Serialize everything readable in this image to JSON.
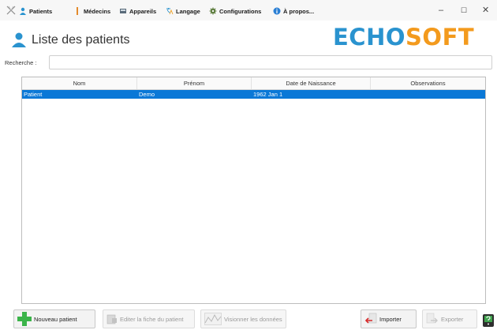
{
  "menu": {
    "items": [
      {
        "label": "Patients",
        "icon": "user-icon"
      },
      {
        "label": "Médecins",
        "icon": "doctor-icon"
      },
      {
        "label": "Appareils",
        "icon": "device-icon"
      },
      {
        "label": "Langage",
        "icon": "language-icon"
      },
      {
        "label": "Configurations",
        "icon": "gear-icon"
      },
      {
        "label": "À propos...",
        "icon": "info-icon"
      }
    ],
    "window_controls": {
      "minimize": "–",
      "maximize": "☐",
      "close": "✕"
    }
  },
  "header": {
    "title": "Liste des patients",
    "logo_part1": "ECHO",
    "logo_part2": "SOFT"
  },
  "search": {
    "label": "Recherche :",
    "value": "",
    "placeholder": ""
  },
  "table": {
    "columns": [
      "Nom",
      "Prénom",
      "Date de Naissance",
      "Observations"
    ],
    "rows": [
      {
        "nom": "Patient",
        "prenom": "Demo",
        "date": "1962 Jan 1",
        "observations": ""
      }
    ],
    "selected_row": 0
  },
  "buttons": {
    "new_patient": "Nouveau patient",
    "edit_patient": "Editer la fiche du patient",
    "view_data": "Visionner les données",
    "import": "Importer",
    "export": "Exporter"
  },
  "colors": {
    "selection": "#0a78d7",
    "logo_blue": "#2a93cf",
    "logo_orange": "#f39a1d",
    "accent_green": "#3bb44a"
  }
}
